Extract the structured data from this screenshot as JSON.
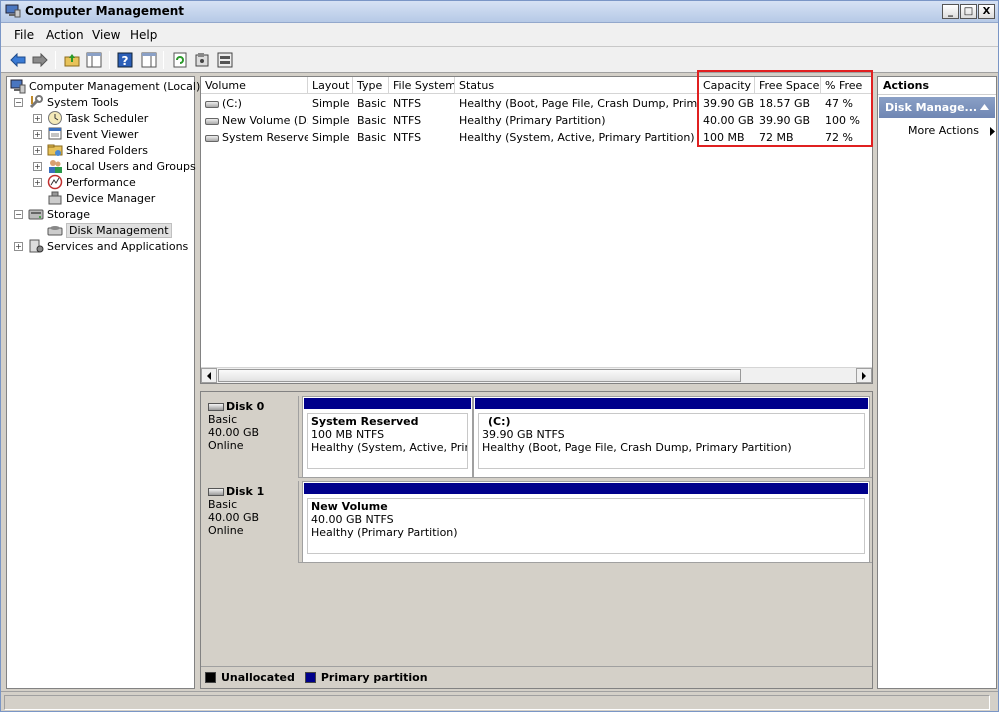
{
  "window": {
    "title": "Computer Management",
    "min": "_",
    "max": "□",
    "close": "X"
  },
  "menu": [
    "File",
    "Action",
    "View",
    "Help"
  ],
  "tree": {
    "root": "Computer Management (Local)",
    "system_tools": "System Tools",
    "task_scheduler": "Task Scheduler",
    "event_viewer": "Event Viewer",
    "shared_folders": "Shared Folders",
    "local_users": "Local Users and Groups",
    "performance": "Performance",
    "device_manager": "Device Manager",
    "storage": "Storage",
    "disk_management": "Disk Management",
    "services": "Services and Applications"
  },
  "volumes": {
    "headers": [
      "Volume",
      "Layout",
      "Type",
      "File System",
      "Status",
      "Capacity",
      "Free Space",
      "% Free"
    ],
    "rows": [
      [
        "(C:)",
        "Simple",
        "Basic",
        "NTFS",
        "Healthy (Boot, Page File, Crash Dump, Primar...",
        "39.90 GB",
        "18.57 GB",
        "47 %"
      ],
      [
        "New Volume (D:)",
        "Simple",
        "Basic",
        "NTFS",
        "Healthy (Primary Partition)",
        "40.00 GB",
        "39.90 GB",
        "100 %"
      ],
      [
        "System Reserved",
        "Simple",
        "Basic",
        "NTFS",
        "Healthy (System, Active, Primary Partition)",
        "100 MB",
        "72 MB",
        "72 %"
      ]
    ]
  },
  "disks": {
    "disk0": {
      "name": "Disk 0",
      "type": "Basic",
      "size": "40.00 GB",
      "state": "Online"
    },
    "disk0_p1": {
      "name": "System Reserved",
      "size": "100 MB NTFS",
      "status": "Healthy (System, Active, Primary"
    },
    "disk0_p2": {
      "name": "(C:)",
      "size": "39.90 GB NTFS",
      "status": "Healthy (Boot, Page File, Crash Dump, Primary Partition)"
    },
    "disk1": {
      "name": "Disk 1",
      "type": "Basic",
      "size": "40.00 GB",
      "state": "Online"
    },
    "disk1_p1": {
      "name": "New Volume",
      "size": "40.00 GB NTFS",
      "status": "Healthy (Primary Partition)"
    }
  },
  "legend": {
    "unallocated": "Unallocated",
    "primary": "Primary partition",
    "unallocated_color": "#000000",
    "primary_color": "#00008b"
  },
  "actions": {
    "header": "Actions",
    "section": "Disk Manage...",
    "more": "More Actions"
  }
}
